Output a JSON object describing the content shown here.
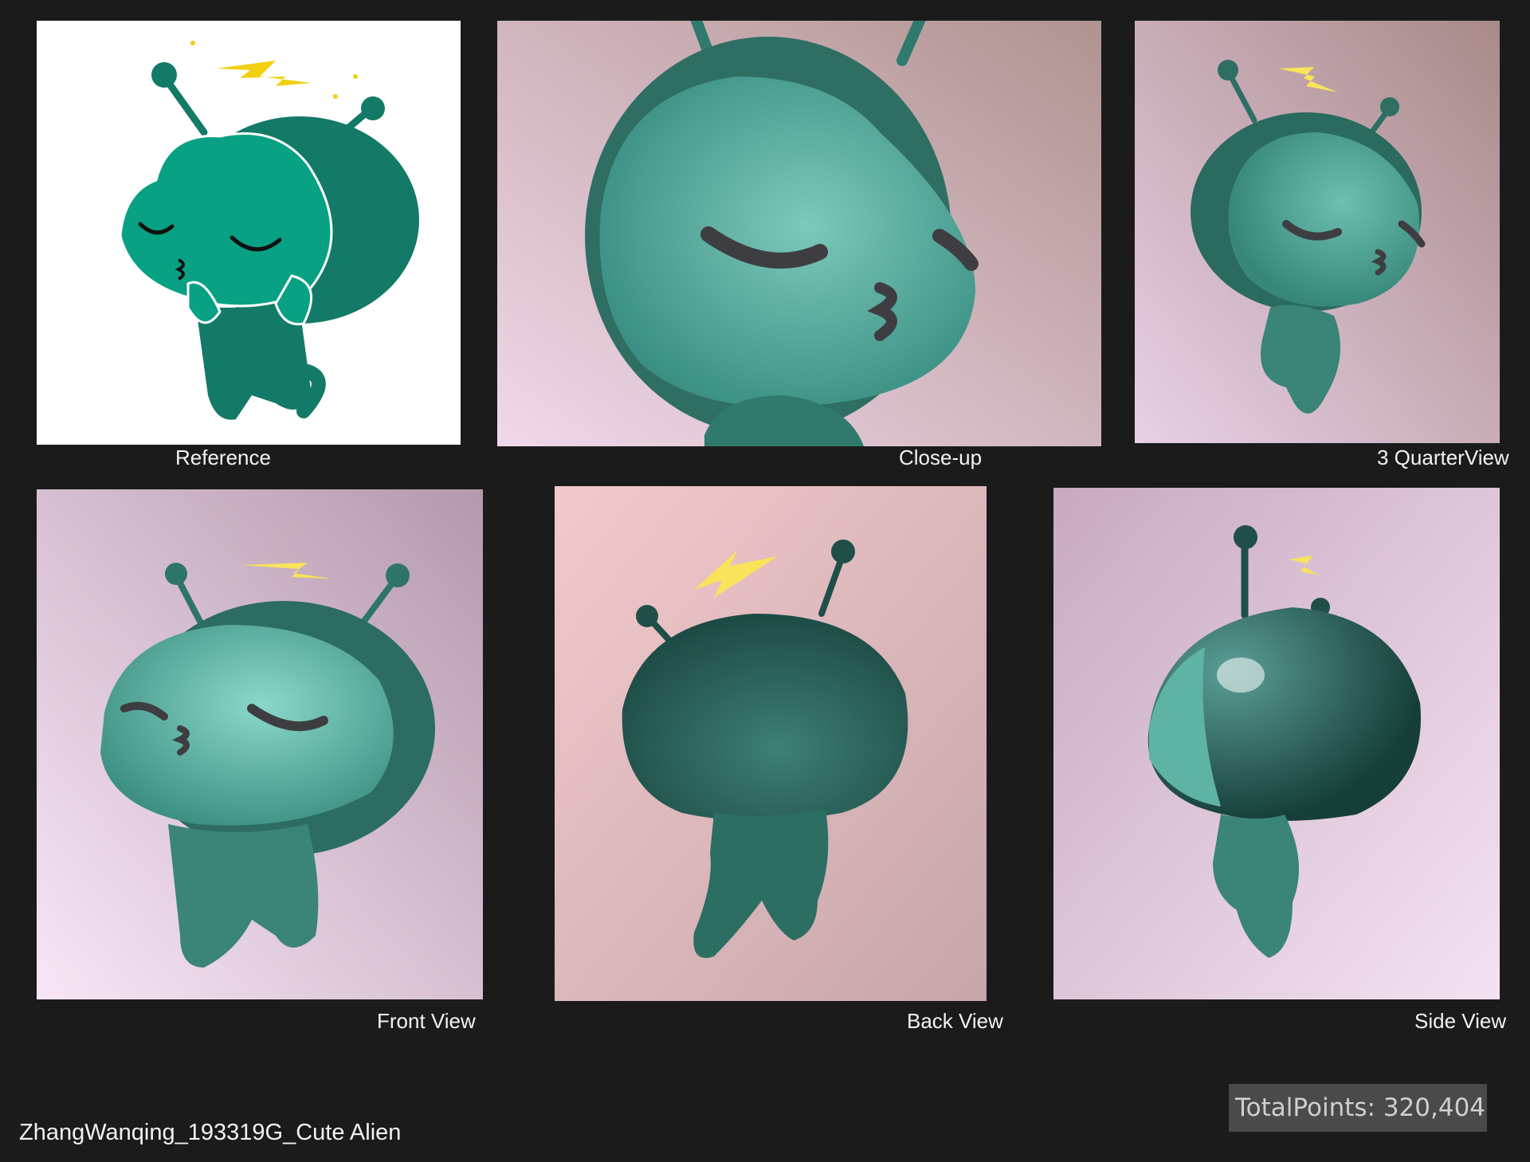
{
  "panels": {
    "reference": "Reference",
    "closeup": "Close-up",
    "three_quarter": "3 QuarterView",
    "front": "Front View",
    "back": "Back View",
    "side": "Side View"
  },
  "footer": {
    "title": "ZhangWanqing_193319G_Cute Alien",
    "total_points": "TotalPoints: 320,404"
  },
  "colors": {
    "background": "#1b1b1b",
    "alien_light": "#3a9a8c",
    "alien_dark": "#1f5a50",
    "bolt": "#f5d63a"
  }
}
